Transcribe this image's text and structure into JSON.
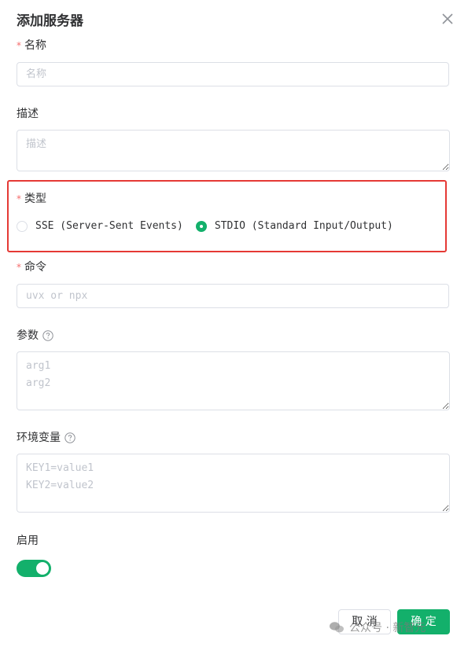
{
  "dialog": {
    "title": "添加服务器",
    "close_icon": "close-icon"
  },
  "fields": {
    "name": {
      "label": "名称",
      "required_mark": "*",
      "placeholder": "名称",
      "value": ""
    },
    "description": {
      "label": "描述",
      "placeholder": "描述",
      "value": ""
    },
    "type": {
      "label": "类型",
      "required_mark": "*",
      "options": [
        {
          "label": "SSE (Server-Sent Events)",
          "checked": false
        },
        {
          "label": "STDIO (Standard Input/Output)",
          "checked": true
        }
      ]
    },
    "command": {
      "label": "命令",
      "required_mark": "*",
      "placeholder": "uvx or npx",
      "value": ""
    },
    "args": {
      "label": "参数",
      "help_icon": "question-circle-icon",
      "placeholder": "arg1\narg2",
      "value": ""
    },
    "env": {
      "label": "环境变量",
      "help_icon": "question-circle-icon",
      "placeholder": "KEY1=value1\nKEY2=value2",
      "value": ""
    },
    "enabled": {
      "label": "启用",
      "on": true
    }
  },
  "footer": {
    "cancel_label": "取 消",
    "ok_label": "确 定"
  },
  "watermark": {
    "text": "公众号 · 新智元"
  },
  "colors": {
    "accent": "#13b06b",
    "required": "#f56c6c",
    "highlight_box": "#e53935",
    "border": "#dcdfe6",
    "placeholder": "#c0c4cc"
  }
}
